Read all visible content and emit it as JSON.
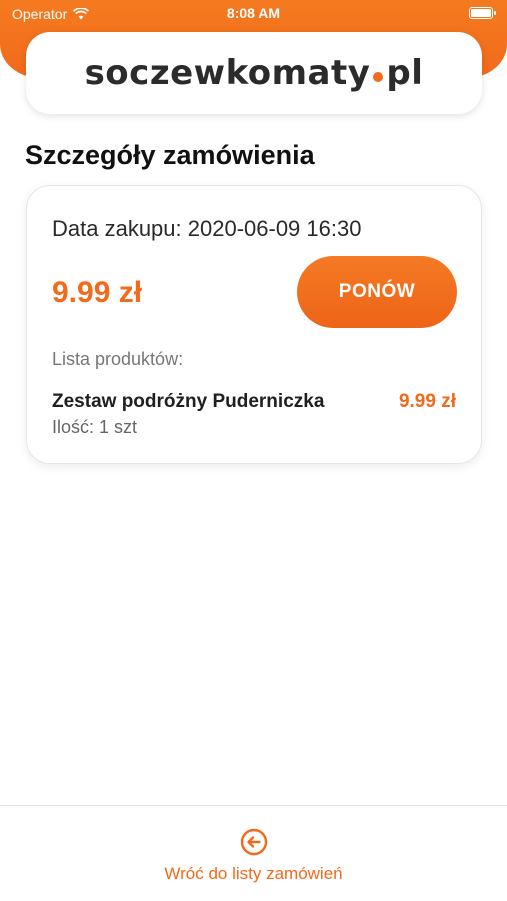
{
  "status_bar": {
    "carrier": "Operator",
    "time": "8:08 AM",
    "icons": [
      "wifi-icon",
      "battery-icon"
    ]
  },
  "brand": {
    "logo_main": "soczewkomaty",
    "logo_suffix": "pl",
    "accent_color": "#f26a1b"
  },
  "page": {
    "title": "Szczegóły zamówienia"
  },
  "order": {
    "purchase_date_label": "Data zakupu: 2020-06-09 16:30",
    "total": "9.99 zł",
    "reorder_label": "PONÓW",
    "products_label": "Lista produktów:",
    "products": [
      {
        "name": "Zestaw podróżny Puderniczka",
        "price": "9.99 zł",
        "quantity": "Ilość: 1 szt"
      }
    ]
  },
  "footer": {
    "back_label": "Wróć do listy zamówień",
    "back_icon": "arrow-left-circle-icon"
  }
}
